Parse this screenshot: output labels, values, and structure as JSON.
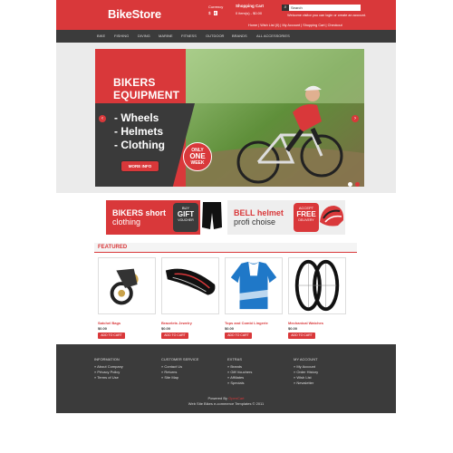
{
  "header": {
    "logo": "BikeStore",
    "currency_label": "Currency",
    "currencies": [
      "$",
      "€"
    ],
    "cart_title": "Shopping Cart",
    "cart_summary": "0 item(s) - $0.00",
    "search_placeholder": "Search",
    "welcome": "Welcome visitor you can login or create an account.",
    "links": [
      "Home",
      "Wish List (0)",
      "My Account",
      "Shopping Cart",
      "Checkout"
    ]
  },
  "nav": [
    "BIKE",
    "FISHING",
    "DIVING",
    "MARINE",
    "FITNESS",
    "OUTDOOR",
    "BRANDS",
    "ALL ACCESSORIES"
  ],
  "slider": {
    "title_line1": "BIKERS",
    "title_line2": "EQUIPMENT",
    "items": [
      "- Wheels",
      "- Helmets",
      "- Clothing"
    ],
    "button": "MORE INFO",
    "badge_line1": "ONLY",
    "badge_line2": "ONE",
    "badge_line3": "WEEK"
  },
  "banners": {
    "left_line1": "BIKERS short",
    "left_line2": "clothing",
    "left_badge_top": "BUY",
    "left_badge_mid": "GIFT",
    "left_badge_bottom": "VOUCHER",
    "right_line1": "BELL helmet",
    "right_line2": "profi choise",
    "right_badge_top": "ACCEPT",
    "right_badge_mid": "FREE",
    "right_badge_bottom": "DELIVERY"
  },
  "featured": {
    "title": "FEATURED",
    "products": [
      {
        "name": "Satchel Bags",
        "price": "$0.00",
        "button": "ADD TO CART"
      },
      {
        "name": "Bracelets Jewelry",
        "price": "$0.00",
        "button": "ADD TO CART"
      },
      {
        "name": "Tops and Combi Lingerie",
        "price": "$0.00",
        "button": "ADD TO CART"
      },
      {
        "name": "Mechanical Watches",
        "price": "$0.00",
        "button": "ADD TO CART"
      }
    ]
  },
  "footer": {
    "columns": [
      {
        "heading": "INFORMATION",
        "links": [
          "About Company",
          "Privacy Policy",
          "Terms of Use"
        ]
      },
      {
        "heading": "CUSTOMER SERVICE",
        "links": [
          "Contact Us",
          "Returns",
          "Site Map"
        ]
      },
      {
        "heading": "EXTRAS",
        "links": [
          "Brands",
          "Gift Vouchers",
          "Affiliates",
          "Specials"
        ]
      },
      {
        "heading": "MY ACCOUNT",
        "links": [
          "My Account",
          "Order History",
          "Wish List",
          "Newsletter"
        ]
      }
    ],
    "powered_by": "Powered By",
    "powered_link": "OpenCart",
    "credit": "Web Site Bikes e-commerce Templates © 2011"
  },
  "colors": {
    "brand_red": "#d9383a",
    "dark_bar": "#3b3b3b",
    "gray_bg": "#ebebeb"
  }
}
